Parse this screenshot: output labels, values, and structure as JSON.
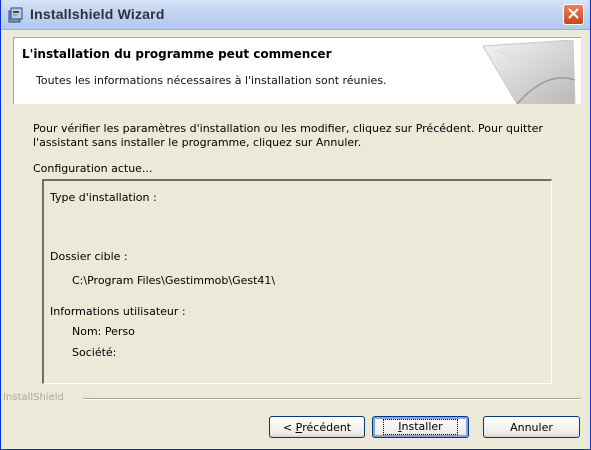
{
  "window": {
    "title": "Installshield Wizard"
  },
  "header": {
    "title": "L'installation du programme peut commencer",
    "subtitle": "Toutes les informations nécessaires à l'installation sont réunies."
  },
  "description": "Pour vérifier les paramètres d'installation ou les modifier, cliquez sur Précédent. Pour quitter l'assistant sans installer le programme, cliquez sur Annuler.",
  "config": {
    "label": "Configuration actue...",
    "install_type_label": "Type d'installation :",
    "target_folder_label": "Dossier cible :",
    "target_folder_value": "C:\\Program Files\\Gestimmob\\Gest41\\",
    "user_info_label": "Informations utilisateur :",
    "user_name": "Nom: Perso",
    "company": "Société:"
  },
  "brand": "InstallShield",
  "buttons": {
    "prev_prefix": "< ",
    "prev_mnemonic": "P",
    "prev_rest": "récédent",
    "install_mnemonic": "I",
    "install_rest": "nstaller",
    "cancel": "Annuler"
  },
  "colors": {
    "dialog_bg": "#ece9d8",
    "title_text": "#2a3340",
    "close_button": "#d0532c",
    "button_border": "#003c74"
  },
  "icons": [
    "installer-icon",
    "close-icon",
    "header-artwork"
  ]
}
